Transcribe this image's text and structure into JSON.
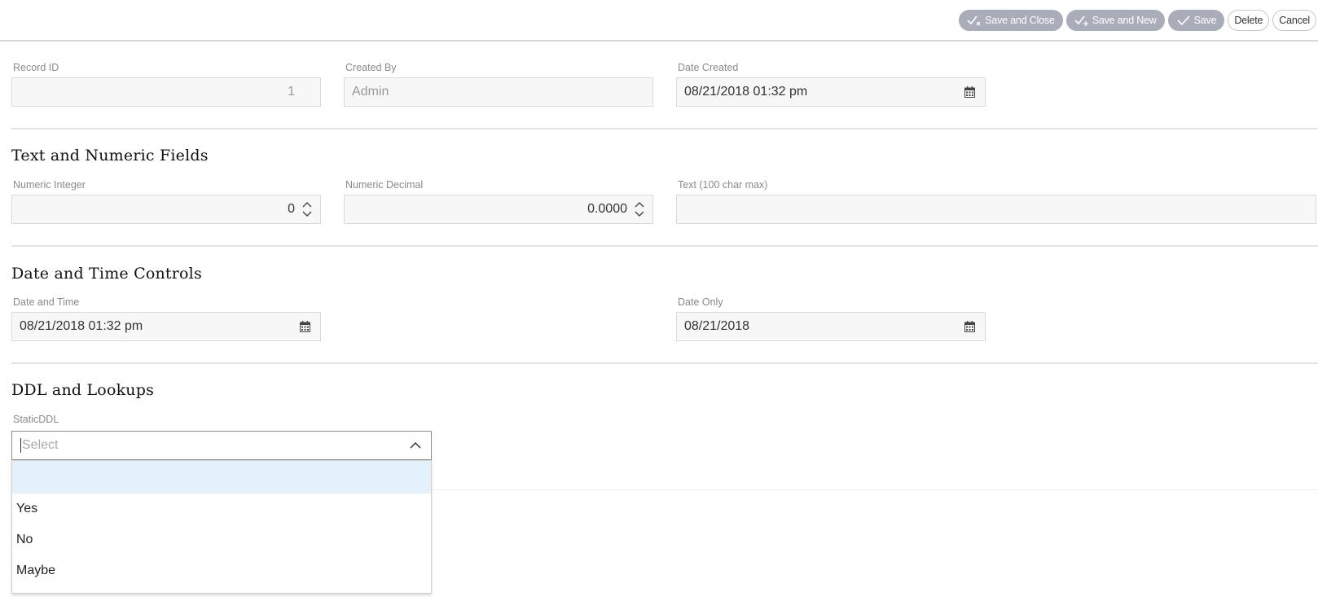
{
  "toolbar": {
    "save_close_label": "Save and Close",
    "save_new_label": "Save and New",
    "save_label": "Save",
    "delete_label": "Delete",
    "cancel_label": "Cancel"
  },
  "header_fields": {
    "record_id": {
      "label": "Record ID",
      "value": "1"
    },
    "created_by": {
      "label": "Created By",
      "value": "Admin"
    },
    "date_created": {
      "label": "Date Created",
      "value": "08/21/2018 01:32 pm"
    }
  },
  "sections": {
    "text_numeric": {
      "title": "Text and Numeric Fields",
      "numeric_integer": {
        "label": "Numeric Integer",
        "value": "0"
      },
      "numeric_decimal": {
        "label": "Numeric Decimal",
        "value": "0.0000"
      },
      "text_field": {
        "label": "Text (100 char max)",
        "value": ""
      }
    },
    "date_time": {
      "title": "Date and Time Controls",
      "date_and_time": {
        "label": "Date and Time",
        "value": "08/21/2018 01:32 pm"
      },
      "date_only": {
        "label": "Date Only",
        "value": "08/21/2018"
      }
    },
    "ddl": {
      "title": "DDL and Lookups",
      "static_ddl": {
        "label": "StaticDDL",
        "placeholder": "Select",
        "options": [
          "",
          "Yes",
          "No",
          "Maybe"
        ]
      }
    }
  },
  "colors": {
    "disabled_button": "#a9adb9",
    "highlight_option": "#e2f1fc",
    "field_background": "#f7f7f7"
  }
}
